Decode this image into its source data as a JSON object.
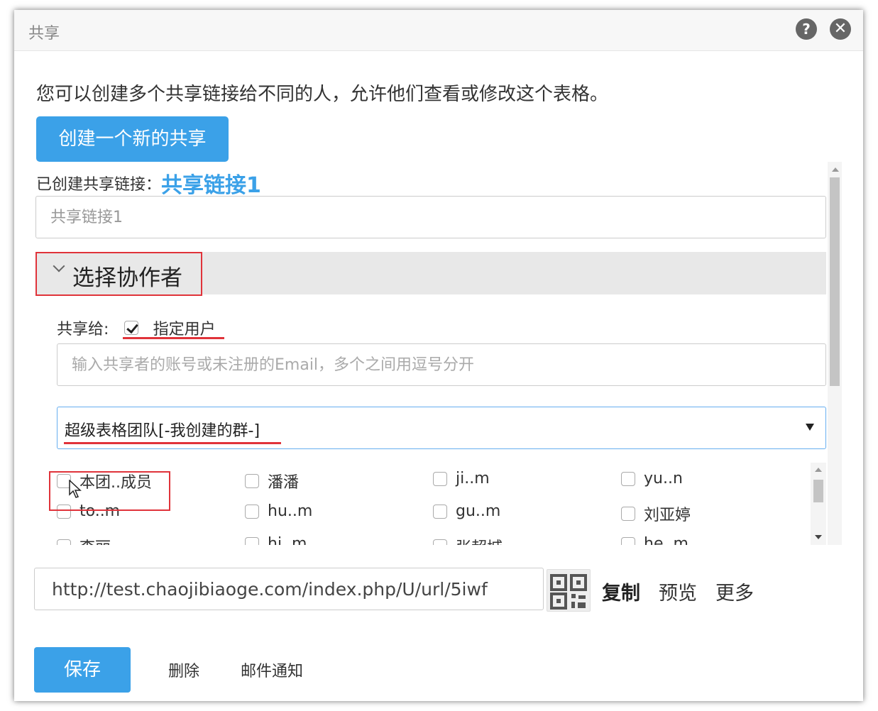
{
  "dialog": {
    "title": "共享",
    "help_icon": "help-icon",
    "close_icon": "close-icon"
  },
  "intro": "您可以创建多个共享链接给不同的人，允许他们查看或修改这个表格。",
  "create_button": "创建一个新的共享",
  "created": {
    "label": "已创建共享链接：",
    "link_name": "共享链接1"
  },
  "link_name_input": {
    "placeholder": "共享链接1"
  },
  "collaborators": {
    "title": "选择协作者",
    "share_to_label": "共享给:",
    "specified_users_label": "指定用户",
    "specified_users_checked": true,
    "email_placeholder": "输入共享者的账号或未注册的Email，多个之间用逗号分开",
    "group_selected": "超级表格团队[-我创建的群-]",
    "members": [
      [
        "本团..成员",
        "潘潘",
        "ji..m",
        "yu..n"
      ],
      [
        "to..m",
        "hu..m",
        "gu..m",
        "刘亚婷"
      ],
      [
        "李丽",
        "hi..m",
        "张超城",
        "he..m"
      ]
    ]
  },
  "share_url": {
    "value": "http://test.chaojibiaoge.com/index.php/U/url/5iwf",
    "qr_icon": "qr-code-icon",
    "copy_label": "复制",
    "preview_label": "预览",
    "more_label": "更多"
  },
  "footer": {
    "save_label": "保存",
    "delete_label": "删除",
    "email_notify_label": "邮件通知"
  },
  "colors": {
    "primary_blue": "#3ba1e8",
    "highlight_red": "#e0333a",
    "section_gray": "#e8e8e8"
  }
}
